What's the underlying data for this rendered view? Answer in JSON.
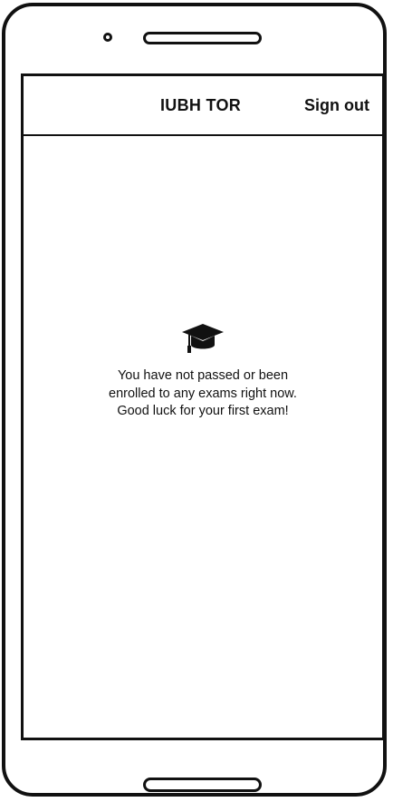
{
  "header": {
    "title": "IUBH TOR",
    "sign_out_label": "Sign out"
  },
  "empty_state": {
    "icon": "graduation-cap-icon",
    "lines": [
      "You have not passed or been",
      "enrolled to any exams right now.",
      "Good luck for your first exam!"
    ]
  }
}
